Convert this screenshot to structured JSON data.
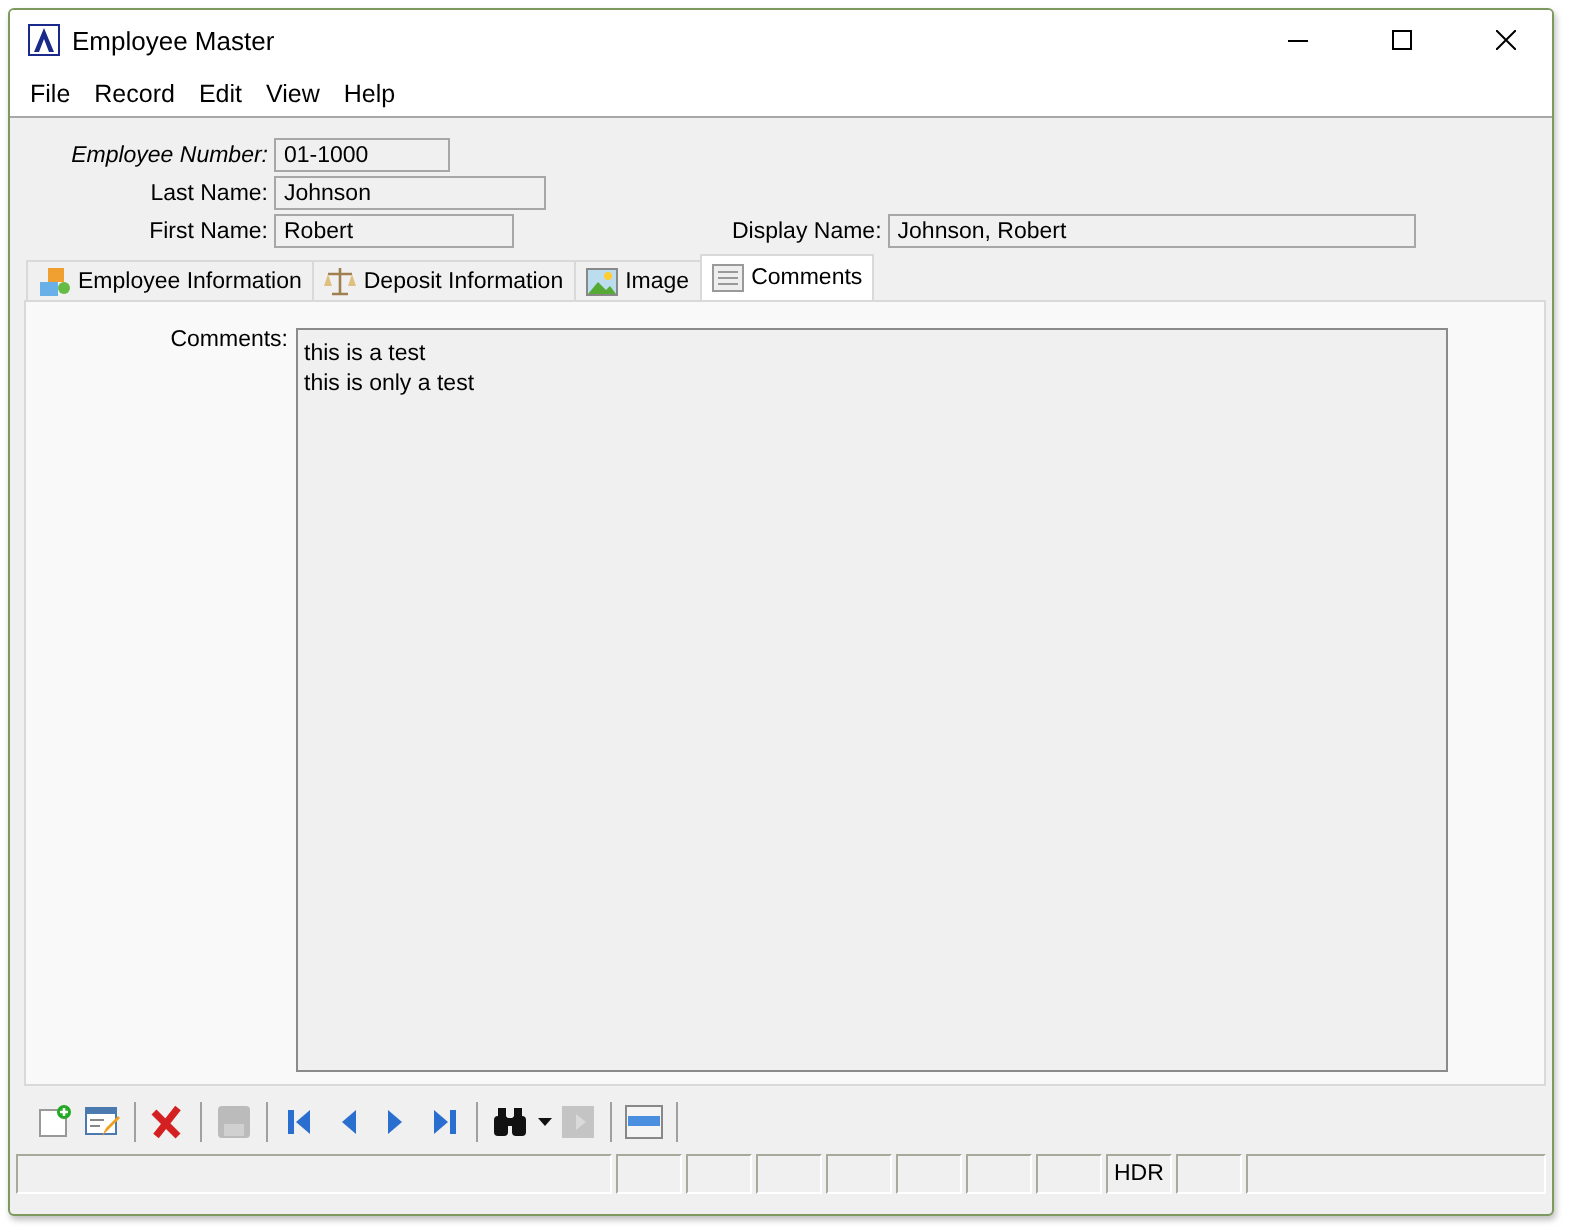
{
  "window": {
    "title": "Employee Master"
  },
  "menu": [
    "File",
    "Record",
    "Edit",
    "View",
    "Help"
  ],
  "header": {
    "employee_number": {
      "label": "Employee Number:",
      "value": "01-1000"
    },
    "last_name": {
      "label": "Last Name:",
      "value": "Johnson"
    },
    "first_name": {
      "label": "First Name:",
      "value": "Robert"
    },
    "display_name": {
      "label": "Display Name:",
      "value": "Johnson, Robert"
    }
  },
  "tabs": [
    {
      "label": "Employee Information",
      "kind": "people",
      "selected": false
    },
    {
      "label": "Deposit Information",
      "kind": "scale",
      "selected": false
    },
    {
      "label": "Image",
      "kind": "image",
      "selected": false
    },
    {
      "label": "Comments",
      "kind": "text",
      "selected": true
    }
  ],
  "comments": {
    "label": "Comments:",
    "lines": [
      "this is a test",
      "this is only a test"
    ]
  },
  "toolbar": [
    {
      "kind": "new",
      "disabled": false
    },
    {
      "kind": "edit",
      "disabled": false
    },
    {
      "kind": "sep"
    },
    {
      "kind": "delete",
      "disabled": false
    },
    {
      "kind": "sep"
    },
    {
      "kind": "save",
      "disabled": true
    },
    {
      "kind": "sep"
    },
    {
      "kind": "first",
      "disabled": false
    },
    {
      "kind": "prev",
      "disabled": false
    },
    {
      "kind": "next",
      "disabled": false
    },
    {
      "kind": "last",
      "disabled": false
    },
    {
      "kind": "sep"
    },
    {
      "kind": "find",
      "disabled": false
    },
    {
      "kind": "dropdown",
      "disabled": false
    },
    {
      "kind": "jump",
      "disabled": true
    },
    {
      "kind": "sep"
    },
    {
      "kind": "list",
      "disabled": false
    },
    {
      "kind": "sep"
    }
  ],
  "status_bar": {
    "indicator": "HDR"
  }
}
